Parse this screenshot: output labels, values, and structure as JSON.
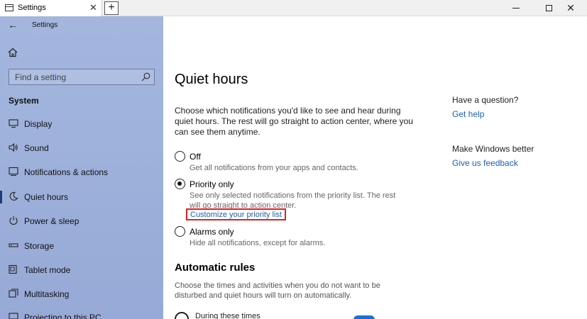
{
  "window": {
    "tab_title": "Settings",
    "tab_close": "✕",
    "new_tab": "+"
  },
  "sidebar": {
    "title": "Settings",
    "search_placeholder": "Find a setting",
    "section": "System",
    "items": [
      {
        "label": "Display",
        "icon": "display-icon",
        "selected": false
      },
      {
        "label": "Sound",
        "icon": "sound-icon",
        "selected": false
      },
      {
        "label": "Notifications & actions",
        "icon": "notifications-icon",
        "selected": false
      },
      {
        "label": "Quiet hours",
        "icon": "moon-icon",
        "selected": true
      },
      {
        "label": "Power & sleep",
        "icon": "power-icon",
        "selected": false
      },
      {
        "label": "Storage",
        "icon": "storage-icon",
        "selected": false
      },
      {
        "label": "Tablet mode",
        "icon": "tablet-icon",
        "selected": false
      },
      {
        "label": "Multitasking",
        "icon": "multitasking-icon",
        "selected": false
      },
      {
        "label": "Projecting to this PC",
        "icon": "projecting-icon",
        "selected": false
      }
    ]
  },
  "main": {
    "title": "Quiet hours",
    "description": "Choose which notifications you'd like to see and hear during quiet hours. The rest will go straight to action center, where you can see them anytime.",
    "options": [
      {
        "label": "Off",
        "sub": "Get all notifications from your apps and contacts.",
        "checked": false
      },
      {
        "label": "Priority only",
        "sub": "See only selected notifications from the priority list. The rest will go straight to action center.",
        "checked": true
      },
      {
        "label": "Alarms only",
        "sub": "Hide all notifications, except for alarms.",
        "checked": false
      }
    ],
    "priority_link": "Customize your priority list",
    "rules_heading": "Automatic rules",
    "rules_desc": "Choose the times and activities when you do not want to be disturbed and quiet hours will turn on automatically.",
    "during_label": "During these times"
  },
  "help": {
    "question_heading": "Have a question?",
    "get_help": "Get help",
    "better_heading": "Make Windows better",
    "feedback": "Give us feedback"
  },
  "colors": {
    "sidebar_bg": "#a0b3dc",
    "link": "#1a5fb4",
    "highlight_box": "#e02020",
    "accent": "#1a6fd0"
  }
}
